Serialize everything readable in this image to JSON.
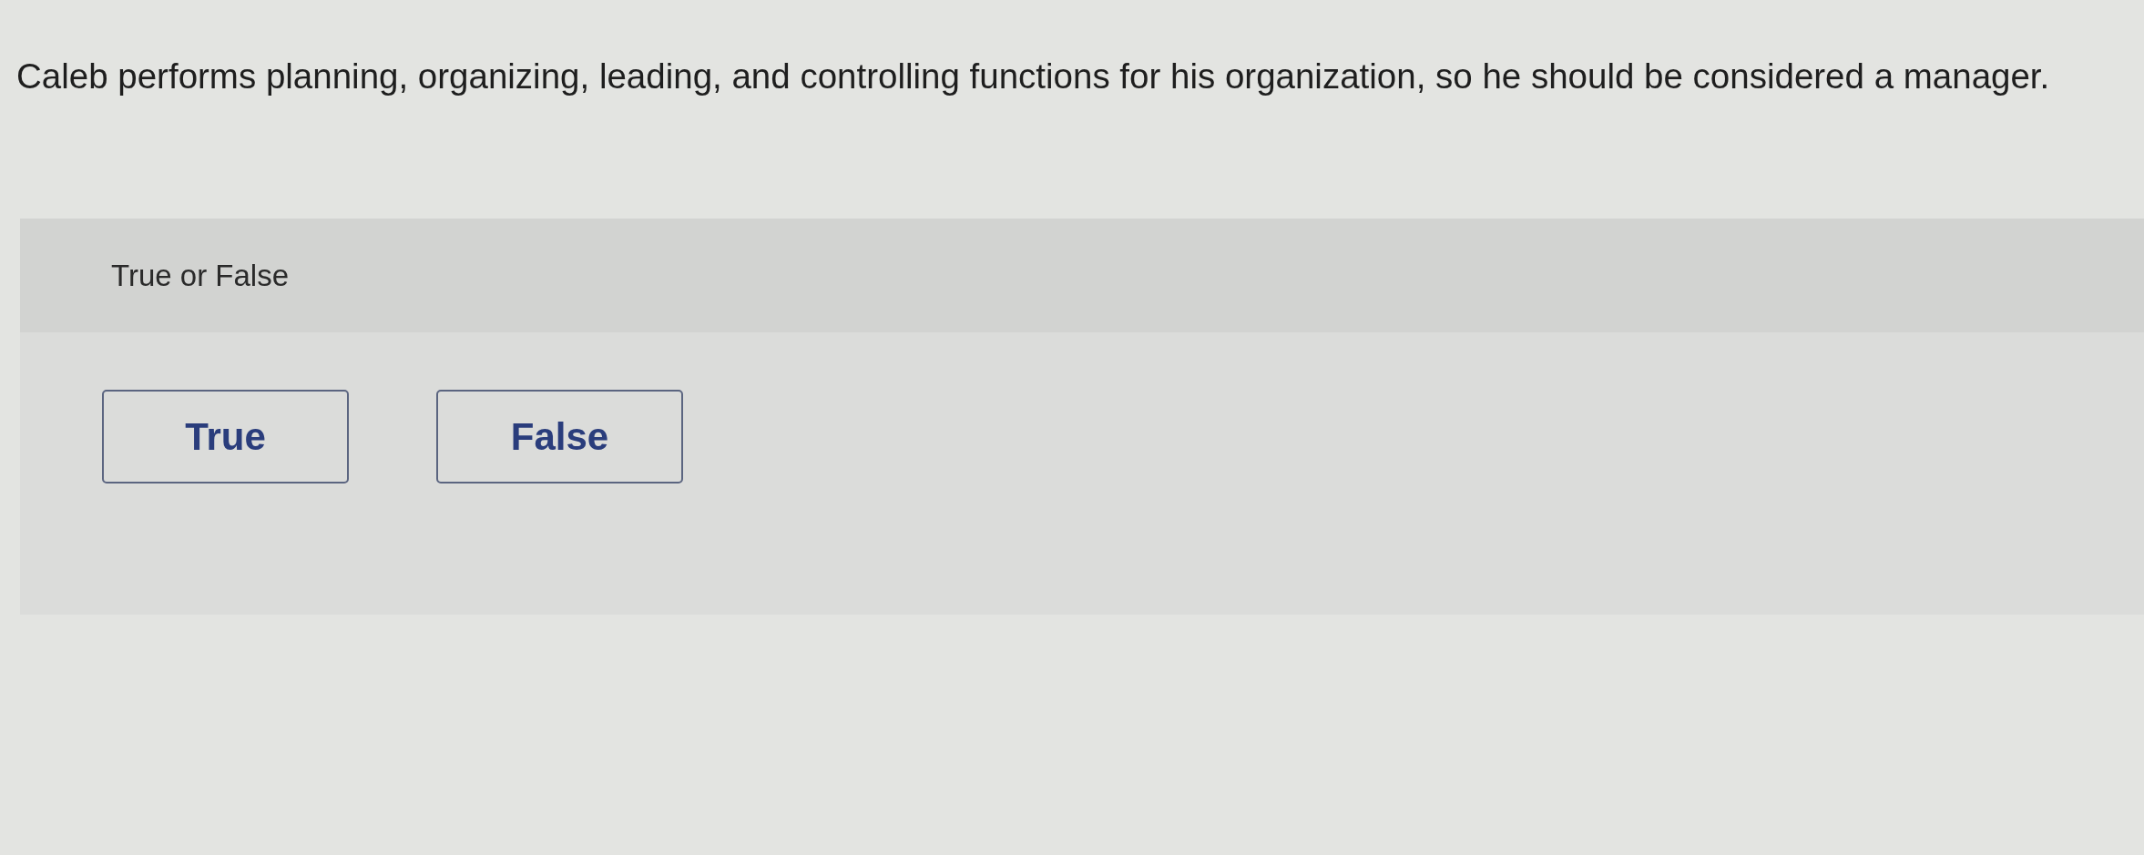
{
  "question": {
    "text": "Caleb performs planning, organizing, leading, and controlling functions for his organization, so he should be considered a manager."
  },
  "answer_panel": {
    "prompt": "True or False",
    "options": [
      {
        "label": "True",
        "selected": false
      },
      {
        "label": "False",
        "selected": false
      }
    ]
  }
}
